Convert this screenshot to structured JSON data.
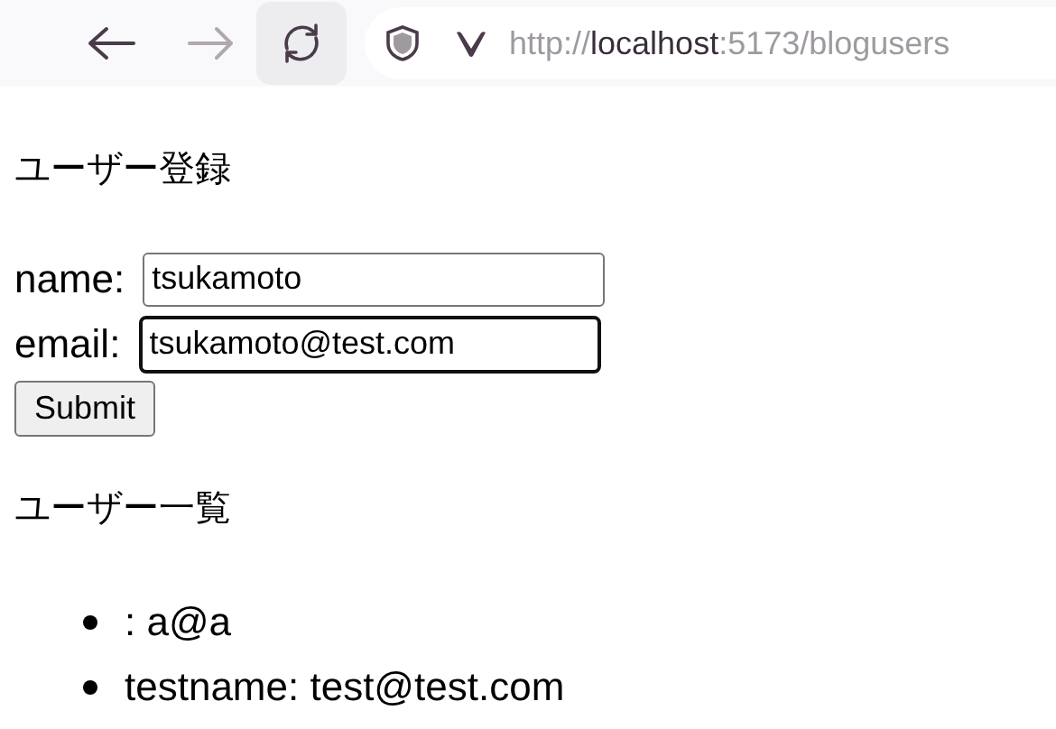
{
  "toolbar": {
    "back": {
      "disabled": false
    },
    "forward": {
      "disabled": true
    },
    "url": {
      "scheme": "http://",
      "host": "localhost",
      "rest": ":5173/blogusers"
    }
  },
  "register_heading": "ユーザー登録",
  "form": {
    "fields": [
      {
        "label": "name:",
        "value": "tsukamoto",
        "focused": false
      },
      {
        "label": "email:",
        "value": "tsukamoto@test.com",
        "focused": true
      }
    ],
    "submit": "Submit"
  },
  "list_heading": "ユーザー一覧",
  "users": [
    ": a@a",
    "testname: test@test.com"
  ]
}
